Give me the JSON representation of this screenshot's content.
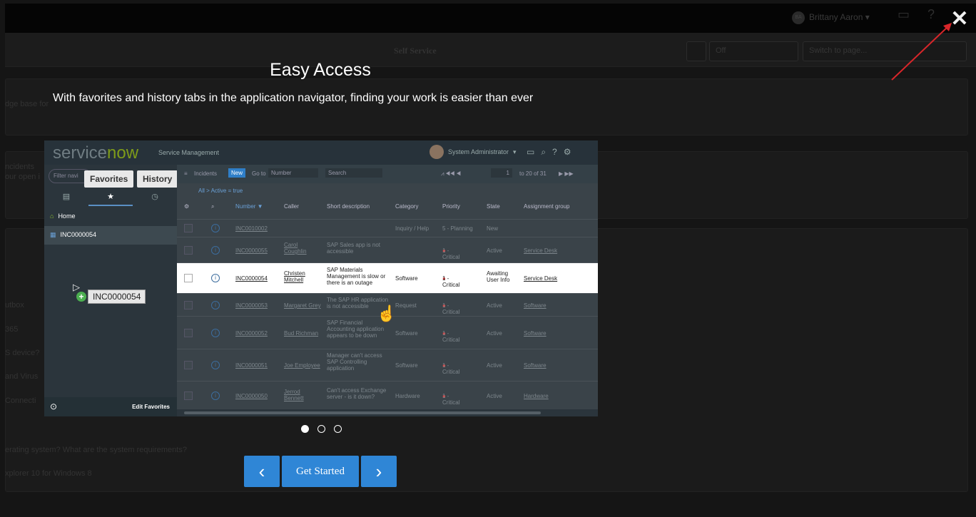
{
  "background": {
    "user_initials": "BA",
    "user_name": "Brittany Aaron",
    "page_title": "Self Service",
    "select_off": "Off",
    "switch_placeholder": "Switch to page...",
    "fragments": {
      "f1": "dge base for",
      "f2": "ncidents",
      "f3": "our open i",
      "f4": "utbox",
      "f5": "365",
      "f6": "S device?",
      "f7": "and Virus",
      "f8": "Connecti",
      "f9": "erating system? What are the system requirements?",
      "f10": "xplorer 10 for Windows 8"
    }
  },
  "modal": {
    "title": "Easy Access",
    "subtitle": "With favorites and history tabs in the application navigator, finding your work is easier than ever",
    "prev_label": "‹",
    "start_label": "Get Started",
    "next_label": "›",
    "close_label": "✕",
    "slide_count": 3,
    "active_slide": 1
  },
  "screenshot": {
    "logo_a": "service",
    "logo_b": "now",
    "product": "Service Management",
    "admin": "System Administrator",
    "filter_placeholder": "Filter navi",
    "tooltip_favorites": "Favorites",
    "tooltip_history": "History",
    "nav_home": "Home",
    "nav_fav": "INC0000054",
    "drag_label": "INC0000054",
    "edit_favorites": "Edit Favorites",
    "toolbar": {
      "incidents": "Incidents",
      "new": "New",
      "goto": "Go to",
      "number": "Number",
      "search": "Search",
      "paging": "1",
      "paging_of": "to 20 of 31"
    },
    "breadcrumb": "All > Active = true",
    "columns": [
      "Number ▼",
      "Caller",
      "Short description",
      "Category",
      "Priority",
      "State",
      "Assignment group"
    ],
    "rows": [
      {
        "number": "INC0010002",
        "caller": "",
        "desc": "",
        "category": "Inquiry / Help",
        "priority": "5 - Planning",
        "state": "New",
        "group": ""
      },
      {
        "number": "INC0000055",
        "caller": "Carol Coughlin",
        "desc": "SAP Sales app is not accessible",
        "category": "",
        "priority": "1 - Critical",
        "state": "Active",
        "group": "Service Desk"
      },
      {
        "number": "INC0000054",
        "caller": "Christen Mitchell",
        "desc": "SAP Materials Management is slow or there is an outage",
        "category": "Software",
        "priority": "1 - Critical",
        "state": "Awaiting User Info",
        "group": "Service Desk"
      },
      {
        "number": "INC0000053",
        "caller": "Margaret Grey",
        "desc": "The SAP HR application is not accessible",
        "category": "Request",
        "priority": "1 - Critical",
        "state": "Active",
        "group": "Software"
      },
      {
        "number": "INC0000052",
        "caller": "Bud Richman",
        "desc": "SAP Financial Accounting application appears to be down",
        "category": "Software",
        "priority": "1 - Critical",
        "state": "Active",
        "group": "Software"
      },
      {
        "number": "INC0000051",
        "caller": "Joe Employee",
        "desc": "Manager can't access SAP Controlling application",
        "category": "Software",
        "priority": "1 - Critical",
        "state": "Active",
        "group": "Software"
      },
      {
        "number": "INC0000050",
        "caller": "Jerrod Bennett",
        "desc": "Can't access Exchange server - is it down?",
        "category": "Hardware",
        "priority": "1 - Critical",
        "state": "Active",
        "group": "Hardware"
      }
    ]
  }
}
